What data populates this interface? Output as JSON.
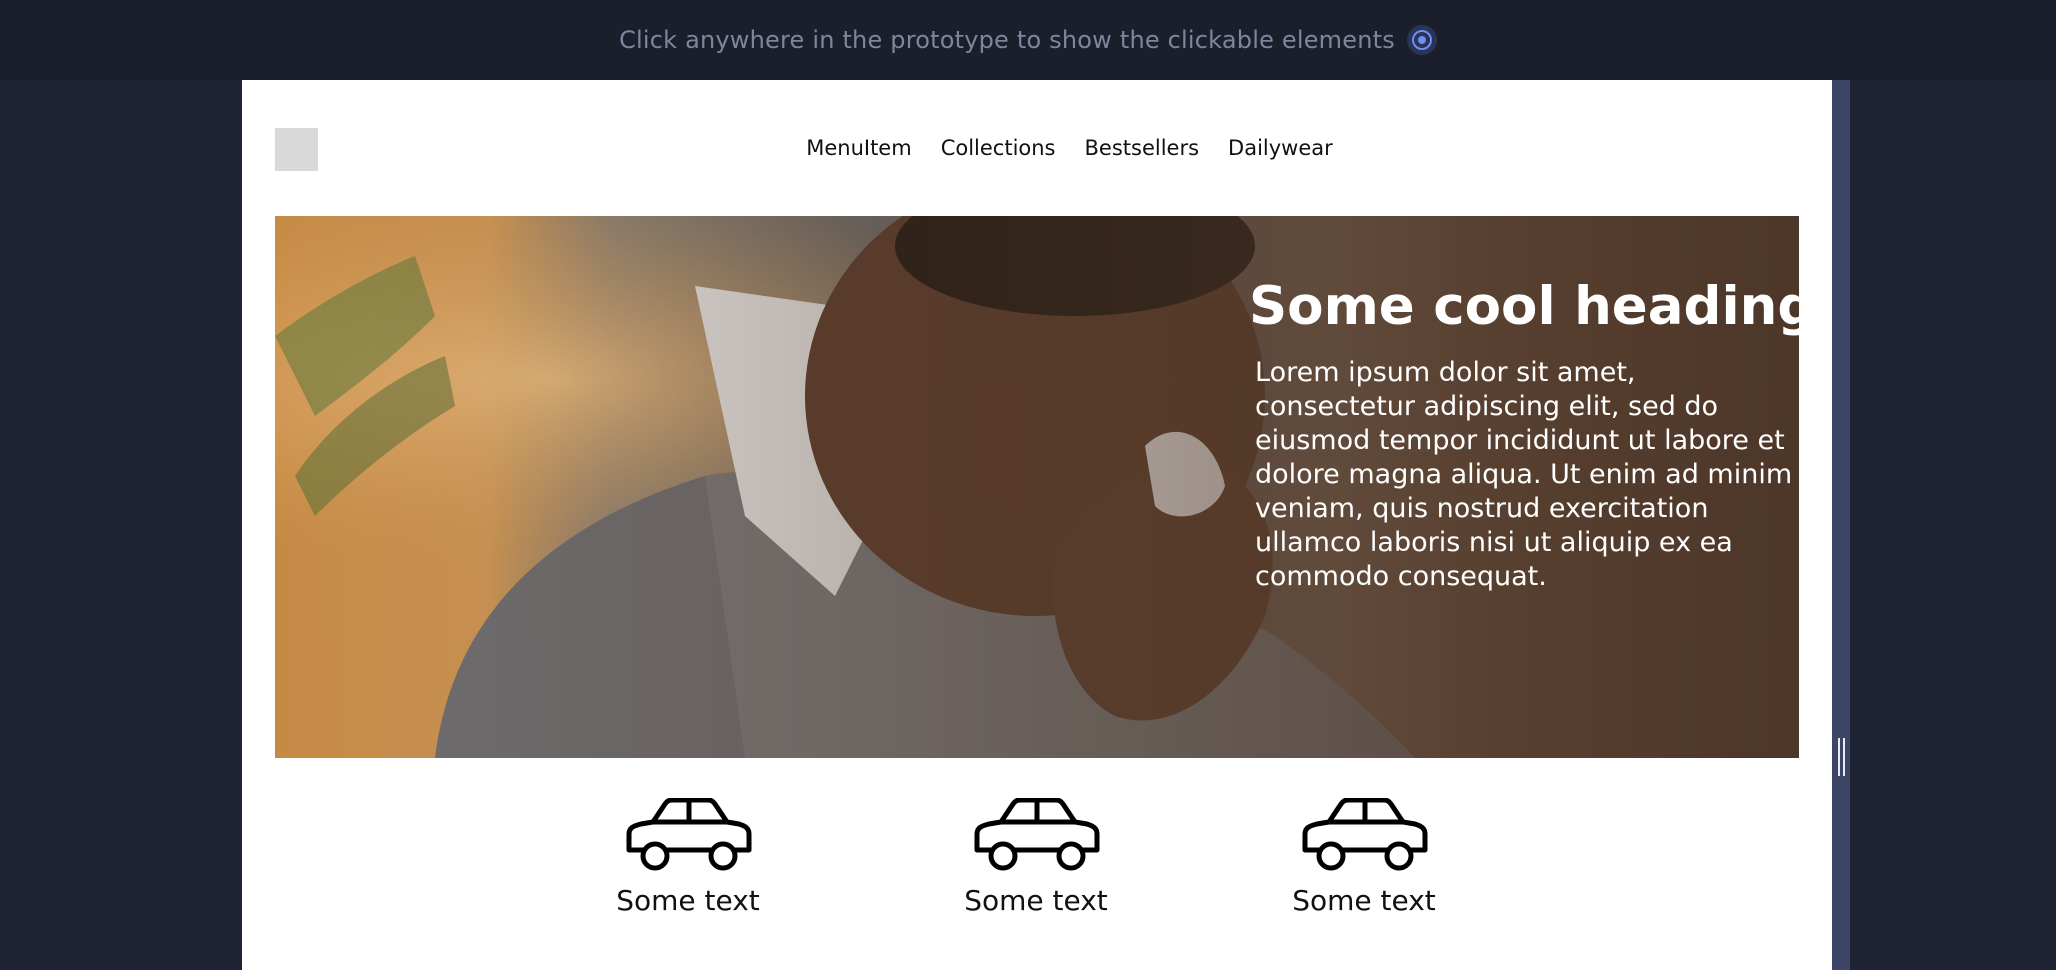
{
  "topbar": {
    "hint": "Click anywhere in the prototype to show the clickable elements",
    "hint_icon": "target-icon"
  },
  "header": {
    "logo": "logo-placeholder",
    "nav": [
      "MenuItem",
      "Collections",
      "Bestsellers",
      "Dailywear"
    ]
  },
  "hero": {
    "heading": "Some cool heading",
    "body": "Lorem ipsum dolor sit amet, consectetur adipiscing elit, sed do eiusmod tempor incididunt ut labore et dolore magna aliqua. Ut enim ad minim veniam, quis nostrud exercitation ullamco laboris nisi ut aliquip ex ea commodo consequat."
  },
  "features": [
    {
      "icon": "car-icon",
      "label": "Some text"
    },
    {
      "icon": "car-icon",
      "label": "Some text"
    },
    {
      "icon": "car-icon",
      "label": "Some text"
    }
  ],
  "colors": {
    "background": "#1f2435",
    "topbar": "#1b1f2c",
    "accent": "#6f8df5",
    "scrollbar": "#3c4566"
  }
}
